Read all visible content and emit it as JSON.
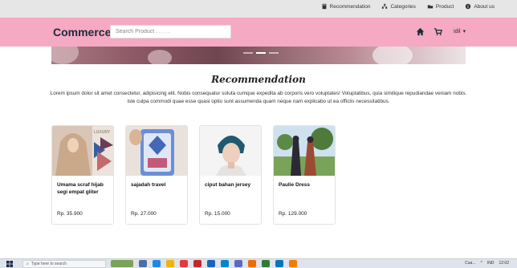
{
  "topnav": [
    {
      "label": "Recommendation",
      "icon": "book-icon"
    },
    {
      "label": "Categories",
      "icon": "sitemap-icon"
    },
    {
      "label": "Product",
      "icon": "folder-icon"
    },
    {
      "label": "About us",
      "icon": "info-icon"
    }
  ],
  "header": {
    "brand": "Commerce",
    "search_placeholder": "Search Product . . . . .",
    "user_name": "idil"
  },
  "banner": {
    "slides": 3,
    "active_slide": 2
  },
  "main": {
    "title": "Recommendation",
    "description": "Lorem ipsum dolor sit amet consectetur, adipisicing elit. Nobis consequatur soluta cumque expedita ab corporis vero voluptates! Voluptatibus, quia similique repudiandae veniam nobis. iste culpa commodi quae esse quasi optio sunt assumenda quam neque nam explicabo ut ea officiis necessitatibus."
  },
  "products": [
    {
      "name": "Umama scraf hijab segi empat gliter",
      "price": "Rp. 35.900"
    },
    {
      "name": "sajadah travel",
      "price": "Rp. 27.000"
    },
    {
      "name": "ciput bahan jersey",
      "price": "Rp. 15.000"
    },
    {
      "name": "Paulie Dress",
      "price": "Rp. 129.000"
    }
  ],
  "product_image_text": {
    "logo": "LUXURY"
  },
  "taskbar": {
    "search_placeholder": "Type here to search",
    "tray_label": "Cua...",
    "language": "IND",
    "time": "12:02"
  },
  "colors": {
    "header_bg": "#f6a9c2",
    "topbar_bg": "#e6e6e6",
    "brand_text": "#1c2a3a"
  }
}
